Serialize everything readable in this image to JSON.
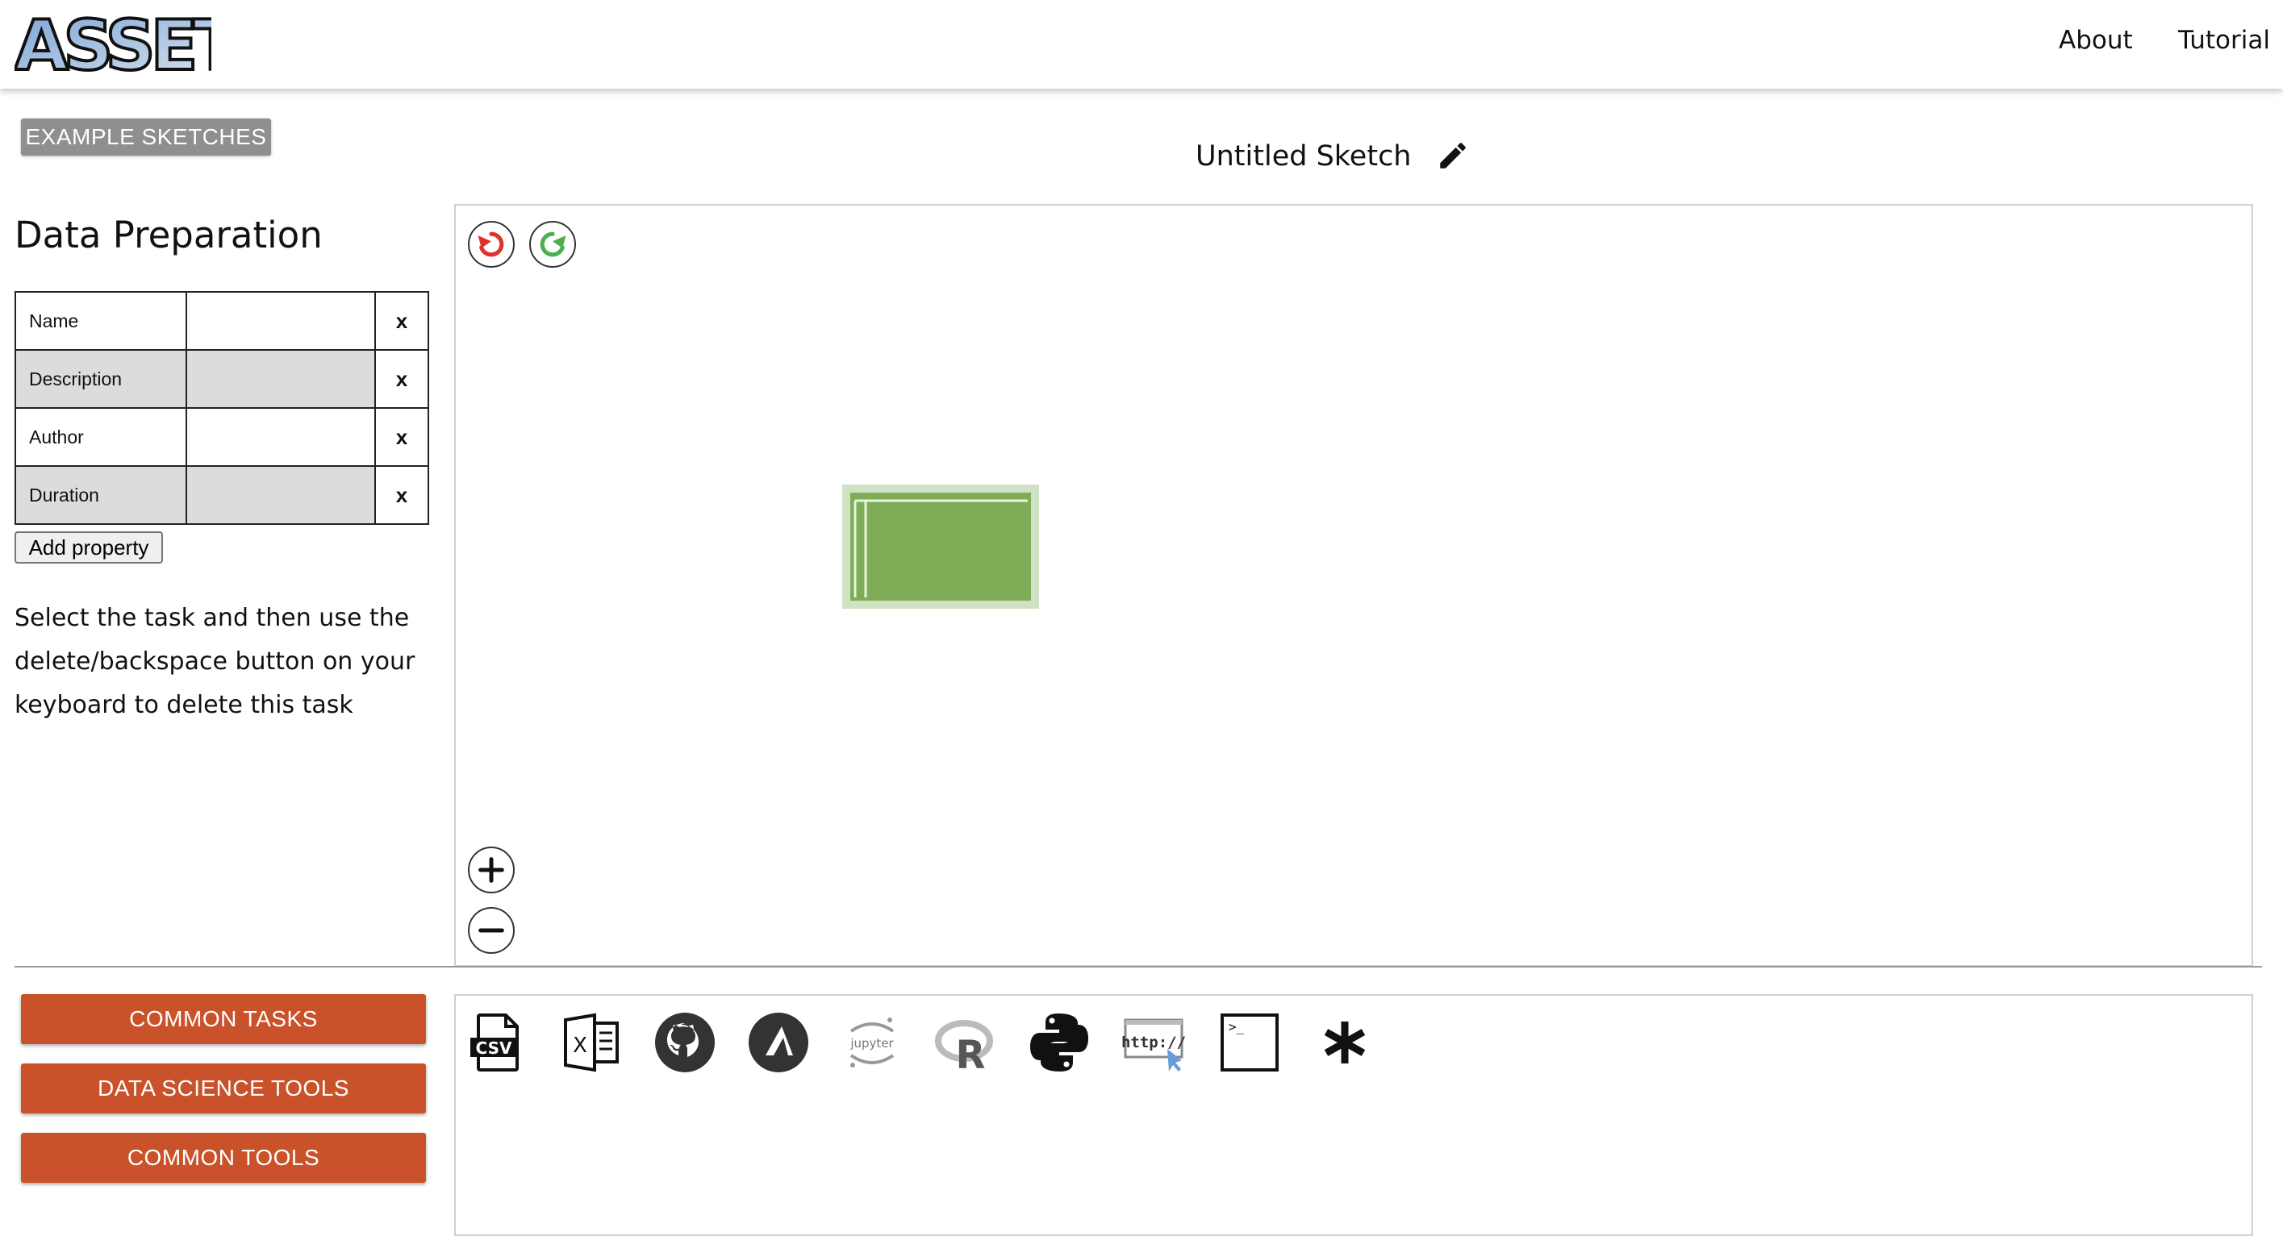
{
  "header": {
    "logo_text": "ASSET",
    "nav": [
      {
        "label": "About"
      },
      {
        "label": "Tutorial"
      }
    ]
  },
  "sidebar": {
    "example_button": "EXAMPLE SKETCHES",
    "task_title": "Data Preparation",
    "properties": [
      {
        "key": "Name",
        "value": "",
        "delete": "x"
      },
      {
        "key": "Description",
        "value": "",
        "delete": "x"
      },
      {
        "key": "Author",
        "value": "",
        "delete": "x"
      },
      {
        "key": "Duration",
        "value": "",
        "delete": "x"
      }
    ],
    "add_property": "Add property",
    "help_text": "Select the task and then use the delete/backspace button on your keyboard to delete this task"
  },
  "sketch": {
    "title": "Untitled Sketch",
    "icons": {
      "edit": "pencil-icon",
      "undo": "undo-icon",
      "redo": "redo-icon",
      "zoom_in": "zoom-in-icon",
      "zoom_out": "zoom-out-icon"
    },
    "colors": {
      "undo": "#e0322b",
      "redo": "#4caf50",
      "task_fill": "#7fad57",
      "task_border": "#cfe3c4"
    }
  },
  "categories": [
    {
      "label": "COMMON TASKS"
    },
    {
      "label": "DATA SCIENCE TOOLS"
    },
    {
      "label": "COMMON TOOLS"
    }
  ],
  "category_color": "#c9522a",
  "tools": [
    {
      "name": "csv-file-icon",
      "label": "CSV"
    },
    {
      "name": "excel-file-icon",
      "label": "X"
    },
    {
      "name": "github-icon",
      "label": ""
    },
    {
      "name": "anaconda-icon",
      "label": ""
    },
    {
      "name": "jupyter-icon",
      "label": "jupyter"
    },
    {
      "name": "r-language-icon",
      "label": "R"
    },
    {
      "name": "python-icon",
      "label": ""
    },
    {
      "name": "web-url-icon",
      "label": "http://"
    },
    {
      "name": "terminal-icon",
      "label": ">_"
    },
    {
      "name": "asterisk-icon",
      "label": ""
    }
  ]
}
